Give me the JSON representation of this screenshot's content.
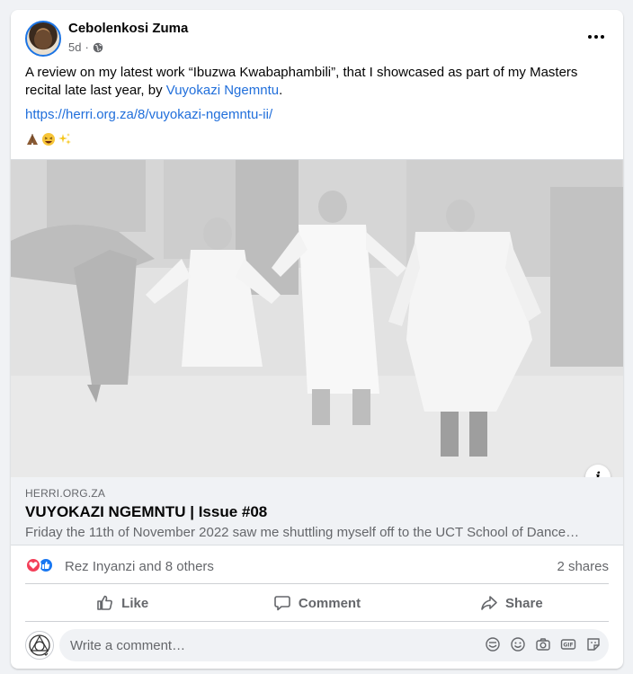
{
  "post": {
    "author": "Cebolenkosi Zuma",
    "time": "5d",
    "separator": "·",
    "text_before": "A review on my latest work “Ibuzwa Kwabaphambili”, that I showcased as part of my Masters recital late last year, by ",
    "mention": "Vuyokazi Ngemntu",
    "text_after": ".",
    "link": "https://herri.org.za/8/vuyokazi-ngemntu-ii/",
    "emojis": [
      "folded-hands",
      "grinning-squinting-face",
      "sparkles"
    ]
  },
  "link_preview": {
    "domain": "HERRI.ORG.ZA",
    "title": "VUYOKAZI NGEMNTU | Issue #08",
    "description": "Friday the 11th of November 2022 saw me shuttling myself off to the UCT School of Dance…",
    "info_label": "i"
  },
  "reactions": {
    "summary": "Rez Inyanzi and 8 others",
    "shares": "2 shares",
    "types": [
      "love",
      "like"
    ]
  },
  "actions": {
    "like": "Like",
    "comment": "Comment",
    "share": "Share"
  },
  "comment": {
    "placeholder": "Write a comment…",
    "tools": [
      "sticker-comment-icon",
      "emoji-icon",
      "camera-icon",
      "gif-icon",
      "sticker-icon"
    ]
  },
  "colors": {
    "accent": "#216fdb",
    "love": "#f33e58",
    "like": "#1877f2",
    "muted": "#65676b"
  }
}
